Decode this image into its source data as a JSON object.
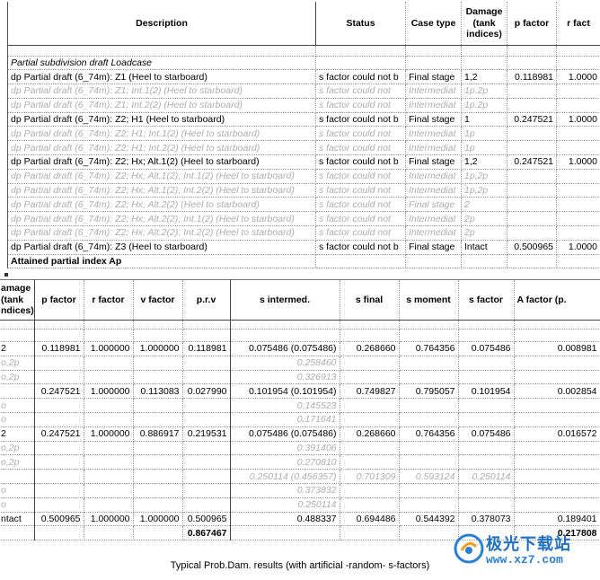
{
  "top_table": {
    "headers": {
      "description": "Description",
      "status": "Status",
      "case_type": "Case type",
      "damage": "Damage (tank indices)",
      "p_factor": "p factor",
      "r_factor": "r fact"
    },
    "section_title": "Partial subdivision draft Loadcase",
    "rows": [
      {
        "style": "normal",
        "description": "dp Partial draft (6_74m): Z1 (Heel to starboard)",
        "status": "s factor could not b",
        "case_type": "Final stage",
        "damage": "1,2",
        "p": "0.118981",
        "r": "1.0000"
      },
      {
        "style": "grey",
        "description": "dp Partial draft (6_74m): Z1; Int.1(2) (Heel to starboard)",
        "status": "s factor could not",
        "case_type": "Intermediat",
        "damage": "1p,2p",
        "p": "",
        "r": ""
      },
      {
        "style": "grey",
        "description": "dp Partial draft (6_74m): Z1; Int.2(2) (Heel to starboard)",
        "status": "s factor could not",
        "case_type": "Intermediat",
        "damage": "1p,2p",
        "p": "",
        "r": ""
      },
      {
        "style": "normal",
        "description": "dp Partial draft (6_74m): Z2; H1 (Heel to starboard)",
        "status": "s factor could not b",
        "case_type": "Final stage",
        "damage": "1",
        "p": "0.247521",
        "r": "1.0000"
      },
      {
        "style": "grey",
        "description": "dp Partial draft (6_74m): Z2; H1; Int.1(2) (Heel to starboard)",
        "status": "s factor could not",
        "case_type": "Intermediat",
        "damage": "1p",
        "p": "",
        "r": ""
      },
      {
        "style": "grey",
        "description": "dp Partial draft (6_74m): Z2; H1; Int.2(2) (Heel to starboard)",
        "status": "s factor could not",
        "case_type": "Intermediat",
        "damage": "1p",
        "p": "",
        "r": ""
      },
      {
        "style": "normal",
        "description": "dp Partial draft (6_74m): Z2; Hx; Alt.1(2) (Heel to starboard)",
        "status": "s factor could not b",
        "case_type": "Final stage",
        "damage": "1,2",
        "p": "0.247521",
        "r": "1.0000"
      },
      {
        "style": "grey",
        "description": "dp Partial draft (6_74m): Z2; Hx; Alt.1(2); Int.1(2) (Heel to starboard)",
        "status": "s factor could not",
        "case_type": "Intermediat",
        "damage": "1p,2p",
        "p": "",
        "r": ""
      },
      {
        "style": "grey",
        "description": "dp Partial draft (6_74m): Z2; Hx; Alt.1(2); Int.2(2) (Heel to starboard)",
        "status": "s factor could not",
        "case_type": "Intermediat",
        "damage": "1p,2p",
        "p": "",
        "r": ""
      },
      {
        "style": "grey",
        "description": "dp Partial draft (6_74m): Z2; Hx; Alt.2(2) (Heel to starboard)",
        "status": "s factor could not",
        "case_type": "Final stage",
        "damage": "2",
        "p": "",
        "r": ""
      },
      {
        "style": "grey",
        "description": "dp Partial draft (6_74m): Z2; Hx; Alt.2(2); Int.1(2) (Heel to starboard)",
        "status": "s factor could not",
        "case_type": "Intermediat",
        "damage": "2p",
        "p": "",
        "r": ""
      },
      {
        "style": "grey",
        "description": "dp Partial draft (6_74m): Z2; Hx; Alt.2(2); Int.2(2) (Heel to starboard)",
        "status": "s factor could not",
        "case_type": "Intermediat",
        "damage": "2p",
        "p": "",
        "r": ""
      },
      {
        "style": "normal",
        "description": "dp Partial draft (6_74m): Z3 (Heel to starboard)",
        "status": "s factor could not b",
        "case_type": "Final stage",
        "damage": "Intact",
        "p": "0.500965",
        "r": "1.0000"
      }
    ],
    "attained_label": "Attained partial index Ap"
  },
  "bottom_table": {
    "headers": {
      "damage": "amage (tank ndices)",
      "p_factor": "p factor",
      "r_factor": "r factor",
      "v_factor": "v factor",
      "prv": "p.r.v",
      "s_intermed": "s intermed.",
      "s_final": "s final",
      "s_moment": "s moment",
      "s_factor": "s factor",
      "a_factor": "A factor (p."
    },
    "rows": [
      {
        "style": "normal",
        "damage": "2",
        "p": "0.118981",
        "r": "1.000000",
        "v": "1.000000",
        "prv": "0.118981",
        "s_int": "0.075486 (0.075486)",
        "s_final": "0.268660",
        "s_moment": "0.764356",
        "s_factor": "0.075486",
        "a": "0.008981"
      },
      {
        "style": "grey",
        "damage": "o,2p",
        "p": "",
        "r": "",
        "v": "",
        "prv": "",
        "s_int": "0.258460",
        "s_final": "",
        "s_moment": "",
        "s_factor": "",
        "a": ""
      },
      {
        "style": "grey",
        "damage": "o,2p",
        "p": "",
        "r": "",
        "v": "",
        "prv": "",
        "s_int": "0.326913",
        "s_final": "",
        "s_moment": "",
        "s_factor": "",
        "a": ""
      },
      {
        "style": "normal",
        "damage": "",
        "p": "0.247521",
        "r": "1.000000",
        "v": "0.113083",
        "prv": "0.027990",
        "s_int": "0.101954 (0.101954)",
        "s_final": "0.749827",
        "s_moment": "0.795057",
        "s_factor": "0.101954",
        "a": "0.002854"
      },
      {
        "style": "grey",
        "damage": "o",
        "p": "",
        "r": "",
        "v": "",
        "prv": "",
        "s_int": "0.145523",
        "s_final": "",
        "s_moment": "",
        "s_factor": "",
        "a": ""
      },
      {
        "style": "grey",
        "damage": "o",
        "p": "",
        "r": "",
        "v": "",
        "prv": "",
        "s_int": "0.171641",
        "s_final": "",
        "s_moment": "",
        "s_factor": "",
        "a": ""
      },
      {
        "style": "normal",
        "damage": "2",
        "p": "0.247521",
        "r": "1.000000",
        "v": "0.886917",
        "prv": "0.219531",
        "s_int": "0.075486 (0.075486)",
        "s_final": "0.268660",
        "s_moment": "0.764356",
        "s_factor": "0.075486",
        "a": "0.016572"
      },
      {
        "style": "grey",
        "damage": "o,2p",
        "p": "",
        "r": "",
        "v": "",
        "prv": "",
        "s_int": "0.391406",
        "s_final": "",
        "s_moment": "",
        "s_factor": "",
        "a": ""
      },
      {
        "style": "grey",
        "damage": "o,2p",
        "p": "",
        "r": "",
        "v": "",
        "prv": "",
        "s_int": "0.270810",
        "s_final": "",
        "s_moment": "",
        "s_factor": "",
        "a": ""
      },
      {
        "style": "grey",
        "damage": "",
        "p": "",
        "r": "",
        "v": "",
        "prv": "",
        "s_int": "0.250114 (0.456357)",
        "s_final": "0.701309",
        "s_moment": "0.593124",
        "s_factor": "0.250114",
        "a": ""
      },
      {
        "style": "grey",
        "damage": "o",
        "p": "",
        "r": "",
        "v": "",
        "prv": "",
        "s_int": "0.373832",
        "s_final": "",
        "s_moment": "",
        "s_factor": "",
        "a": ""
      },
      {
        "style": "grey",
        "damage": "o",
        "p": "",
        "r": "",
        "v": "",
        "prv": "",
        "s_int": "0.250114",
        "s_final": "",
        "s_moment": "",
        "s_factor": "",
        "a": ""
      },
      {
        "style": "normal",
        "damage": "ntact",
        "p": "0.500965",
        "r": "1.000000",
        "v": "1.000000",
        "prv": "0.500965",
        "s_int": "0.488337",
        "s_final": "0.694486",
        "s_moment": "0.544392",
        "s_factor": "0.378073",
        "a": "0.189401"
      }
    ],
    "totals": {
      "prv": "0.867467",
      "a": "0.217808"
    }
  },
  "caption": "Typical Prob.Dam. results (with artificial -random- s-factors)",
  "watermark": {
    "text": "极光下载站",
    "url": "www.xz7.com"
  },
  "colors": {
    "grey_text": "#aeaeae",
    "watermark_blue": "#1f6fbf"
  }
}
